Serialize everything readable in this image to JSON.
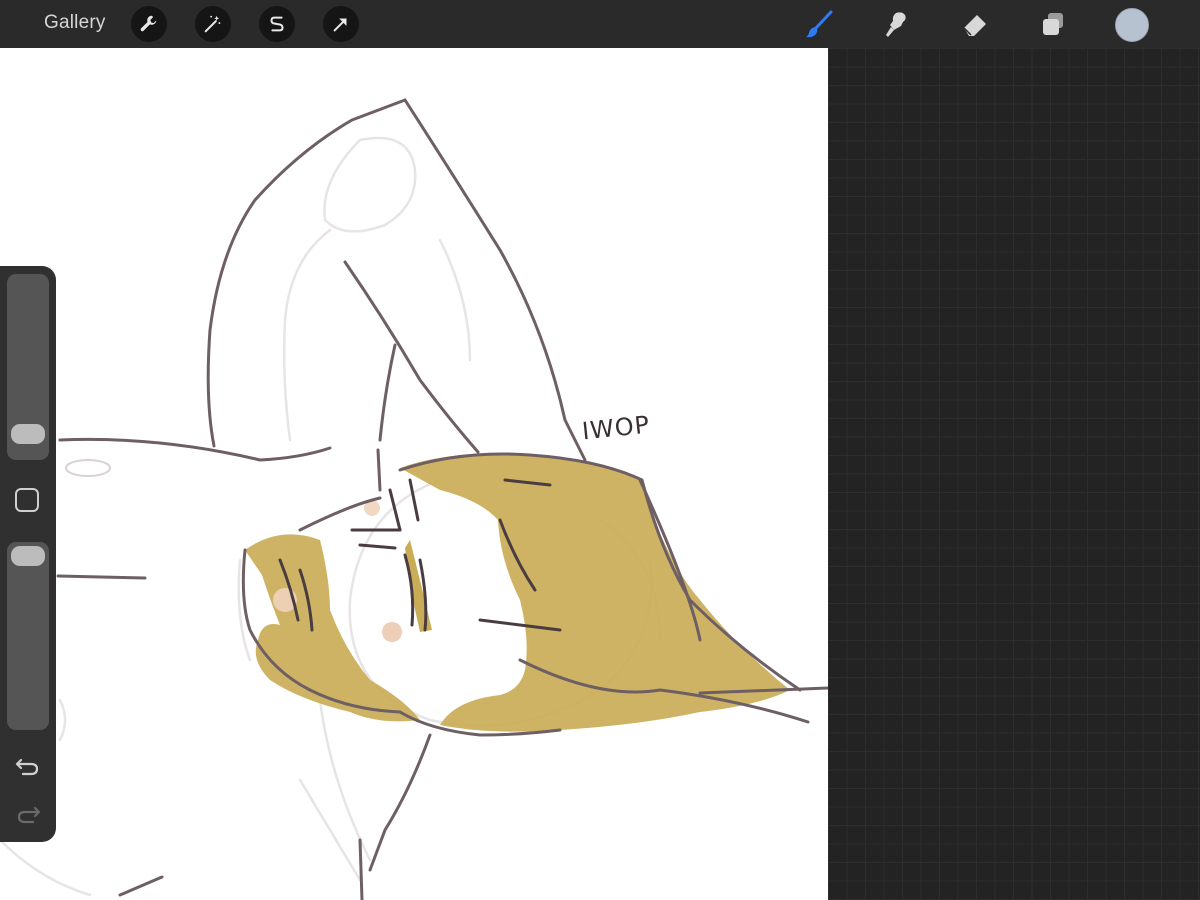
{
  "toolbar": {
    "gallery_label": "Gallery",
    "left_tools": [
      "wrench-icon",
      "magic-wand-icon",
      "selection-s-icon",
      "transform-arrow-icon"
    ],
    "right_tools": [
      "brush-icon",
      "smudge-icon",
      "eraser-icon",
      "layers-icon"
    ],
    "active_tool": "brush",
    "active_color": "#b6c2d0",
    "accent": "#2f7bf5"
  },
  "sidebar": {
    "brush_size_level": 0.15,
    "opacity_level": 0.95,
    "controls": [
      "brush-size-slider",
      "modifier-button",
      "opacity-slider",
      "undo-button",
      "redo-button"
    ]
  },
  "canvas": {
    "handwritten_text": "IWOP"
  }
}
